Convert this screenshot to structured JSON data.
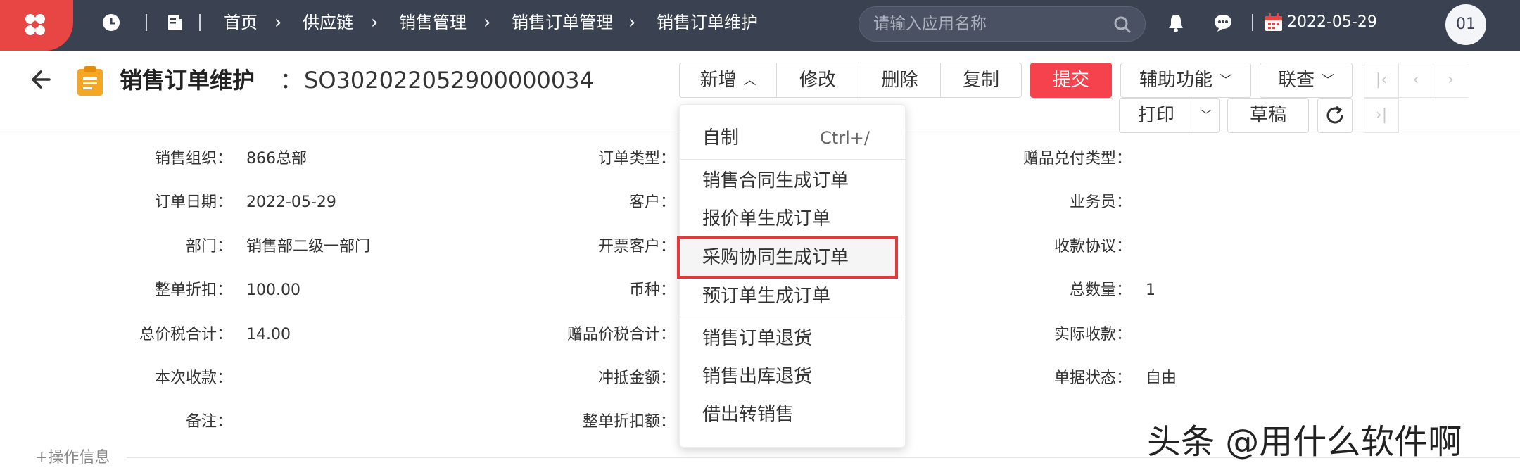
{
  "topbar": {
    "breadcrumbs": [
      "首页",
      "供应链",
      "销售管理",
      "销售订单管理",
      "销售订单维护"
    ],
    "search_placeholder": "请输入应用名称",
    "date": "2022-05-29",
    "avatar_text": "01",
    "colors": {
      "bar": "#3a4252",
      "logo": "#e84545"
    }
  },
  "header": {
    "title": "销售订单维护",
    "colon": "：",
    "order_no": "SO302022052900000034"
  },
  "toolbar": {
    "add_label": "新增",
    "edit_label": "修改",
    "delete_label": "删除",
    "copy_label": "复制",
    "submit_label": "提交",
    "aux_label": "辅助功能",
    "linked_label": "联查",
    "print_label": "打印",
    "draft_label": "草稿",
    "submit_color": "#f5424d"
  },
  "dropdown": {
    "items": [
      {
        "label": "自制",
        "shortcut": "Ctrl+/"
      },
      {
        "label": "销售合同生成订单"
      },
      {
        "label": "报价单生成订单"
      },
      {
        "label": "采购协同生成订单",
        "highlighted": true
      },
      {
        "label": "预订单生成订单"
      },
      {
        "label": "销售订单退货"
      },
      {
        "label": "销售出库退货"
      },
      {
        "label": "借出转销售"
      }
    ]
  },
  "form": {
    "col1": [
      {
        "label": "销售组织：",
        "value": "866总部"
      },
      {
        "label": "订单日期：",
        "value": "2022-05-29"
      },
      {
        "label": "部门：",
        "value": "销售部二级一部门"
      },
      {
        "label": "整单折扣：",
        "value": "100.00"
      },
      {
        "label": "总价税合计：",
        "value": "14.00"
      },
      {
        "label": "本次收款：",
        "value": ""
      },
      {
        "label": "备注：",
        "value": ""
      }
    ],
    "col2": [
      {
        "label": "订单类型："
      },
      {
        "label": "客户："
      },
      {
        "label": "开票客户："
      },
      {
        "label": "币种："
      },
      {
        "label": "赠品价税合计："
      },
      {
        "label": "冲抵金额："
      },
      {
        "label": "整单折扣额："
      }
    ],
    "col3": [
      {
        "label": "赠品兑付类型：",
        "value": ""
      },
      {
        "label": "业务员：",
        "value": ""
      },
      {
        "label": "收款协议：",
        "value": ""
      },
      {
        "label": "总数量：",
        "value": "1"
      },
      {
        "label": "实际收款：",
        "value": ""
      },
      {
        "label": "单据状态：",
        "value": "自由"
      }
    ]
  },
  "footer": {
    "ops_info": "+操作信息",
    "watermark": "头条 @用什么软件啊"
  }
}
